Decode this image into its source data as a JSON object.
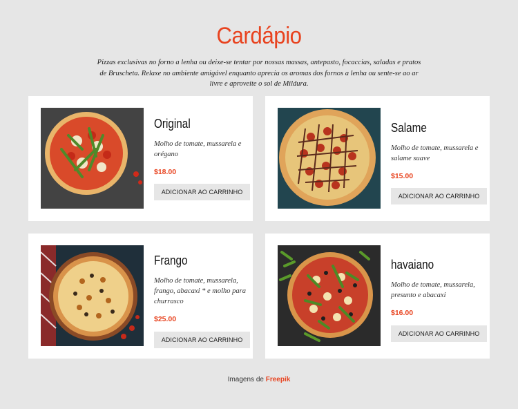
{
  "header": {
    "title": "Cardápio",
    "intro": "Pizzas exclusivas no forno a lenha ou deixe-se tentar por nossas massas, antepasto, focaccias, saladas e pratos de Bruscheta. Relaxe no ambiente amigável enquanto aprecia os aromas dos fornos a lenha ou sente-se ao ar livre e aproveite o sol de Mildura."
  },
  "items": [
    {
      "name": "Original",
      "description": "Molho de tomate, mussarela e orégano",
      "price": "$18.00",
      "button_label": "ADICIONAR AO CARRINHO"
    },
    {
      "name": "Salame",
      "description": "Molho de tomate, mussarela e salame suave",
      "price": "$15.00",
      "button_label": "ADICIONAR AO CARRINHO"
    },
    {
      "name": "Frango",
      "description": "Molho de tomate, mussarela, frango, abacaxi * e molho para churrasco",
      "price": "$25.00",
      "button_label": "ADICIONAR AO CARRINHO"
    },
    {
      "name": "havaiano",
      "description": "Molho de tomate, mussarela, presunto e abacaxi",
      "price": "$16.00",
      "button_label": "ADICIONAR AO CARRINHO"
    }
  ],
  "footer": {
    "credit_prefix": "Imagens de",
    "credit_link": "Freepik"
  },
  "colors": {
    "accent": "#e8431f",
    "background": "#e6e6e6",
    "card": "#ffffff",
    "button": "#e6e6e6"
  }
}
